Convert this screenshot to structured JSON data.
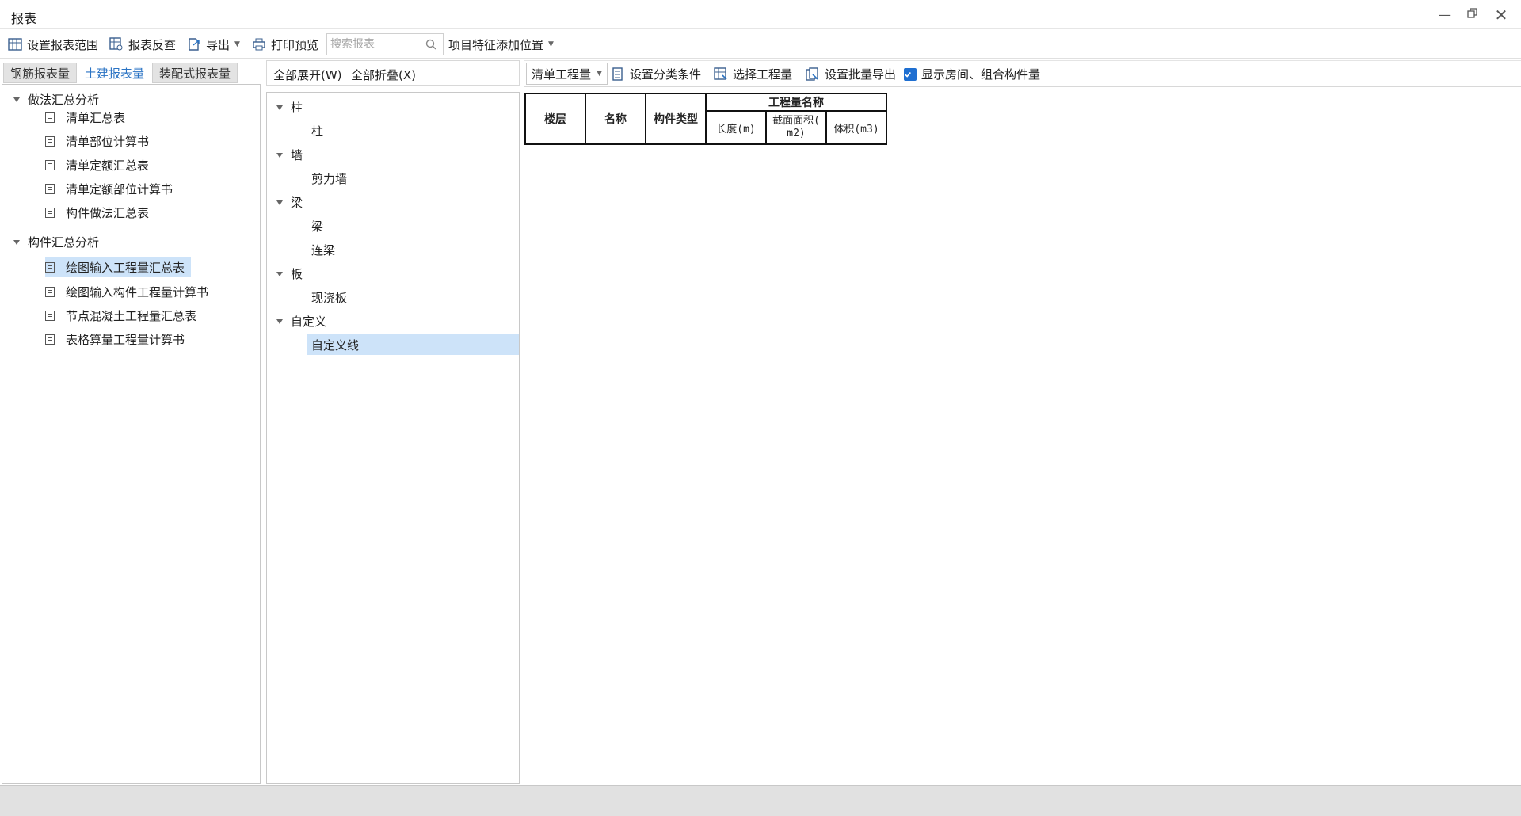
{
  "window": {
    "title": "报表"
  },
  "toolbar": {
    "set_range": "设置报表范围",
    "report_check": "报表反查",
    "export": "导出",
    "print_preview": "打印预览",
    "search_placeholder": "搜索报表",
    "add_feature_position": "项目特征添加位置"
  },
  "left": {
    "tabs": [
      "钢筋报表量",
      "土建报表量",
      "装配式报表量"
    ],
    "active_tab": "土建报表量",
    "groups": [
      {
        "label": "做法汇总分析",
        "items": [
          "清单汇总表",
          "清单部位计算书",
          "清单定额汇总表",
          "清单定额部位计算书",
          "构件做法汇总表"
        ]
      },
      {
        "label": "构件汇总分析",
        "items": [
          "绘图输入工程量汇总表",
          "绘图输入构件工程量计算书",
          "节点混凝土工程量汇总表",
          "表格算量工程量计算书"
        ]
      }
    ],
    "selected": "绘图输入工程量汇总表"
  },
  "middle": {
    "expand_all": "全部展开(W)",
    "collapse_all": "全部折叠(X)",
    "groups": [
      {
        "label": "柱",
        "items": [
          "柱"
        ]
      },
      {
        "label": "墙",
        "items": [
          "剪力墙"
        ]
      },
      {
        "label": "梁",
        "items": [
          "梁",
          "连梁"
        ]
      },
      {
        "label": "板",
        "items": [
          "现浇板"
        ]
      },
      {
        "label": "自定义",
        "items": [
          "自定义线"
        ]
      }
    ],
    "selected": "自定义线"
  },
  "right": {
    "quantity_dropdown": "清单工程量",
    "set_classification": "设置分类条件",
    "select_quantity": "选择工程量",
    "batch_export": "设置批量导出",
    "show_rooms_label": "显示房间、组合构件量",
    "show_rooms_checked": true
  },
  "table": {
    "col_floor": "楼层",
    "col_name": "名称",
    "col_type": "构件类型",
    "group_header": "工程量名称",
    "sub_length": "长度(m)",
    "sub_section_line1": "截面面积(",
    "sub_section_line2": "m2)",
    "sub_volume": "体积(m3)"
  }
}
